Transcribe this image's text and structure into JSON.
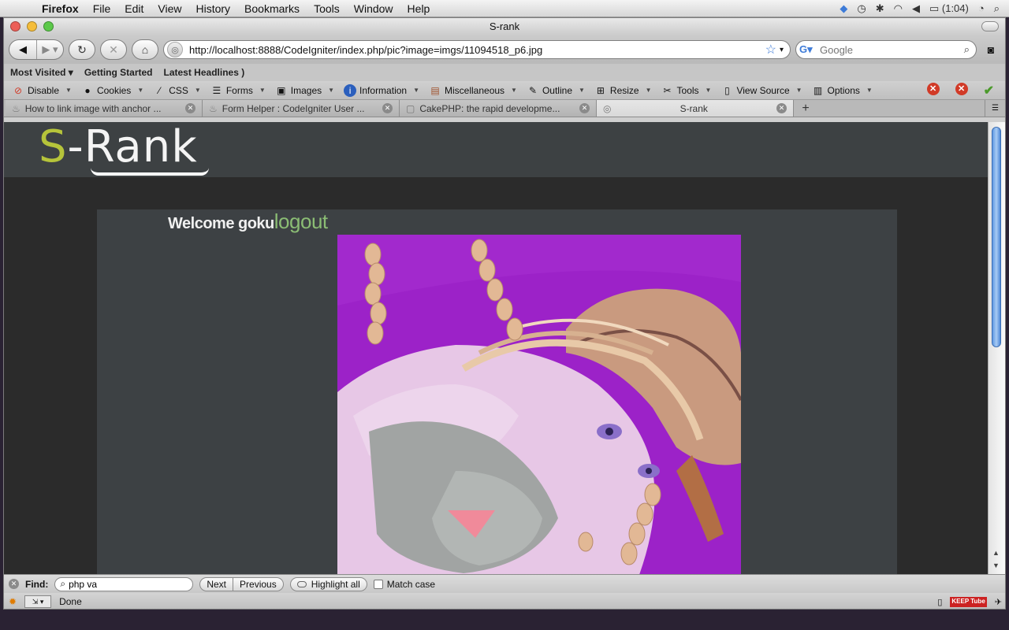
{
  "menubar": {
    "apple": "",
    "items": [
      "Firefox",
      "File",
      "Edit",
      "View",
      "History",
      "Bookmarks",
      "Tools",
      "Window",
      "Help"
    ],
    "battery": "(1:04)"
  },
  "window": {
    "title": "S-rank"
  },
  "nav": {
    "url": "http://localhost:8888/CodeIgniter/index.php/pic?image=imgs/11094518_p6.jpg",
    "search_placeholder": "Google"
  },
  "bookmarks": [
    "Most Visited",
    "Getting Started",
    "Latest Headlines"
  ],
  "devbar": [
    "Disable",
    "Cookies",
    "CSS",
    "Forms",
    "Images",
    "Information",
    "Miscellaneous",
    "Outline",
    "Resize",
    "Tools",
    "View Source",
    "Options"
  ],
  "tabs": [
    {
      "label": "How to link image with anchor ..."
    },
    {
      "label": "Form Helper : CodeIgniter User ..."
    },
    {
      "label": "CakePHP: the rapid developme..."
    },
    {
      "label": "S-rank"
    }
  ],
  "page": {
    "logo_s": "S",
    "logo_rest": "-Rank",
    "welcome": "Welcome goku",
    "logout": "logout"
  },
  "findbar": {
    "label": "Find:",
    "query": "php va",
    "next": "Next",
    "previous": "Previous",
    "highlight": "Highlight all",
    "matchcase": "Match case"
  },
  "status": {
    "text": "Done",
    "tube": "KEEP Tube"
  },
  "colors": {
    "accent": "#b6c43a",
    "logout": "#8bbd74",
    "artwork_bg": "#9a1fc6"
  }
}
